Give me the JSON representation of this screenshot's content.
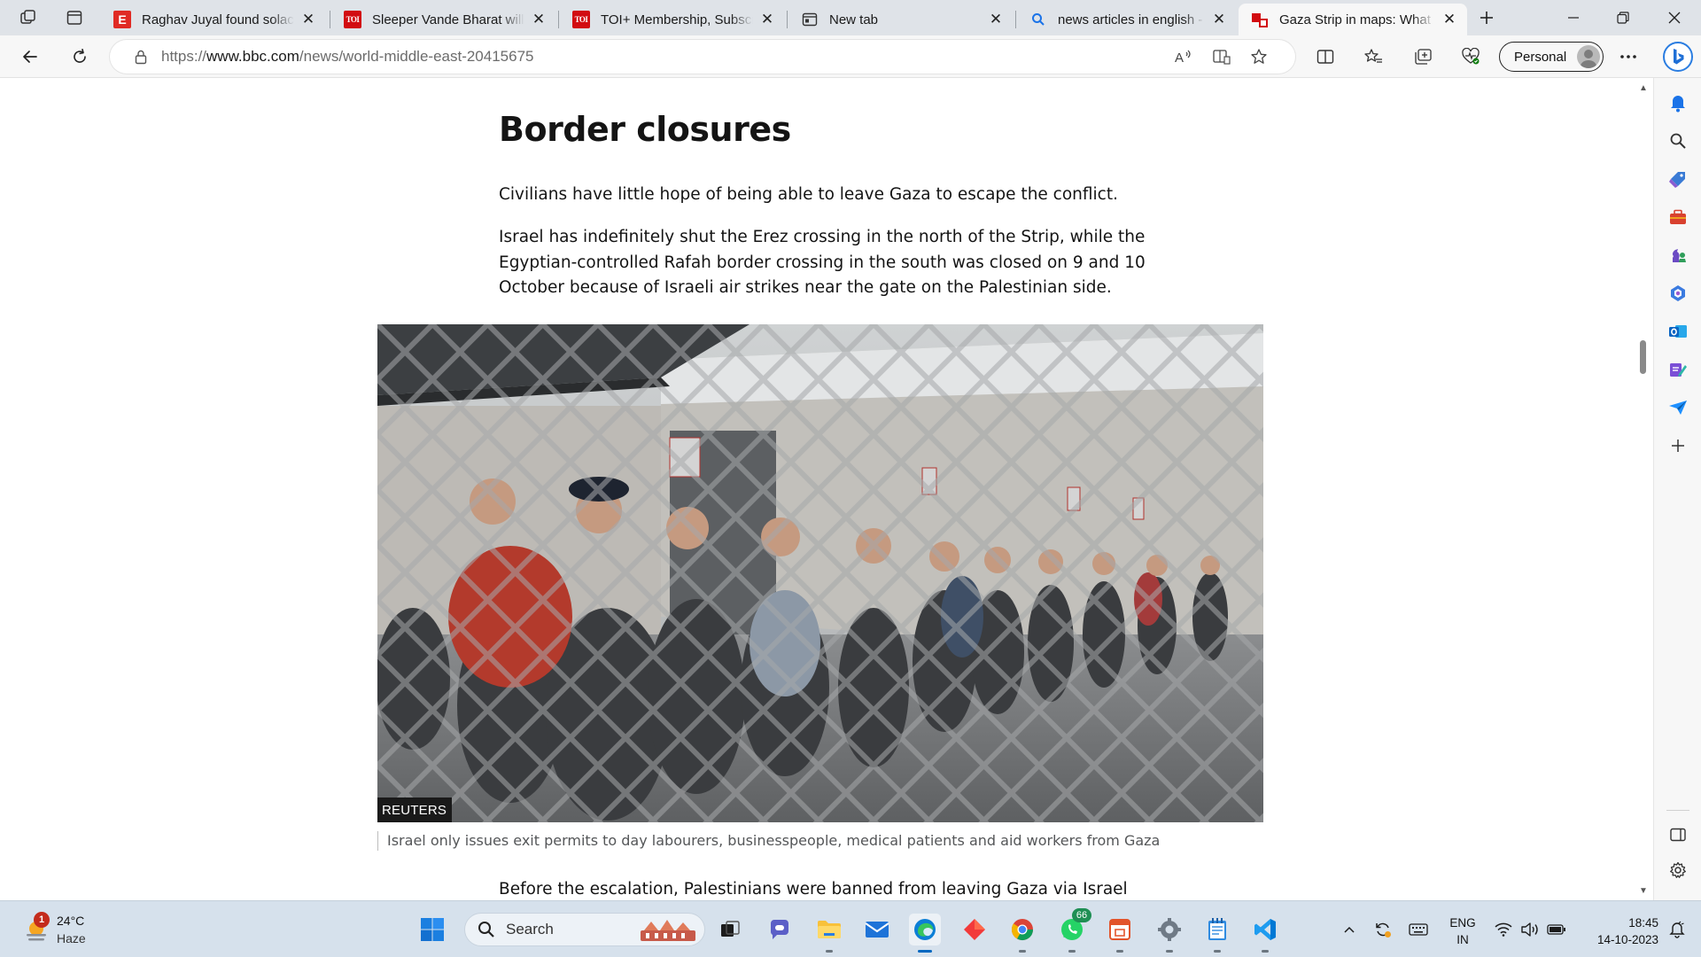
{
  "browser": {
    "tabs": [
      {
        "title": "Raghav Juyal found solace",
        "favicon": "E",
        "favicon_type": "letter-e-red",
        "active": false
      },
      {
        "title": "Sleeper Vande Bharat will c",
        "favicon": "TOI",
        "favicon_type": "toi",
        "active": false
      },
      {
        "title": "TOI+ Membership, Subscri",
        "favicon": "TOI",
        "favicon_type": "toi",
        "active": false
      },
      {
        "title": "New tab",
        "favicon_type": "newtab-icon",
        "active": false
      },
      {
        "title": "news articles in english - S",
        "favicon_type": "search-icon",
        "active": false
      },
      {
        "title": "Gaza Strip in maps: What i",
        "favicon_type": "bbc-map-icon",
        "active": true
      }
    ],
    "address_url_prefix": "https://",
    "address_url_domain": "www.bbc.com",
    "address_url_path": "/news/world-middle-east-20415675",
    "profile_label": "Personal"
  },
  "article": {
    "heading": "Border closures",
    "paragraphs": [
      "Civilians have little hope of being able to leave Gaza to escape the conflict.",
      "Israel has indefinitely shut the Erez crossing in the north of the Strip, while the Egyptian-controlled Rafah border crossing in the south was closed on 9 and 10 October because of Israeli air strikes near the gate on the Palestinian side.",
      "Before the escalation, Palestinians were banned from leaving Gaza via Israel"
    ],
    "image_credit": "REUTERS",
    "image_caption": "Israel only issues exit permits to day labourers, businesspeople, medical patients and aid workers from Gaza"
  },
  "taskbar": {
    "weather_temp": "24°C",
    "weather_condition": "Haze",
    "weather_badge": "1",
    "search_placeholder": "Search",
    "whatsapp_badge": "66",
    "language_line1": "ENG",
    "language_line2": "IN",
    "time": "18:45",
    "date": "14-10-2023"
  },
  "colors": {
    "accent": "#0067c0",
    "tabstrip": "#dfe3e8",
    "toolbar": "#f7f7f7",
    "taskbar": "#d6e1ec",
    "bbc_red": "#bb1919"
  }
}
